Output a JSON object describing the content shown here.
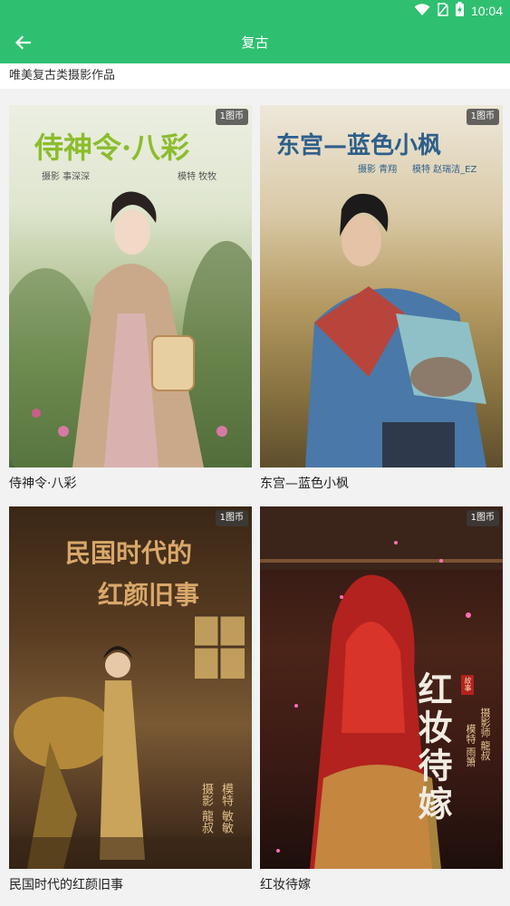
{
  "status_bar": {
    "time": "10:04"
  },
  "app_bar": {
    "title": "复古"
  },
  "category": {
    "description": "唯美复古类摄影作品"
  },
  "works": [
    {
      "caption": "侍神令·八彩",
      "price": "1图币",
      "poster_title": "侍神令·八彩",
      "credit_photo": "摄影 事深深",
      "credit_model": "模特 牧牧"
    },
    {
      "caption": "东宫—蓝色小枫",
      "price": "1图币",
      "poster_title": "东宫—蓝色小枫",
      "credit_photo": "摄影 青翔",
      "credit_model": "模特 赵瑞洁_EZ"
    },
    {
      "caption": "民国时代的红颜旧事",
      "price": "1图币",
      "poster_line1": "民国时代的",
      "poster_line2": "红颜旧事",
      "credit_photo": "摄影 龍叔",
      "credit_model": "模特 敏敏"
    },
    {
      "caption": "红妆待嫁",
      "price": "1图币",
      "poster_title": "红妆待嫁",
      "seal": "故事",
      "credit_photo": "摄影师 龍叔",
      "credit_model": "模特 雨箫"
    }
  ],
  "colors": {
    "primary": "#2fbf71",
    "background": "#f2f2f2",
    "badge_bg": "#3c3c3c"
  }
}
